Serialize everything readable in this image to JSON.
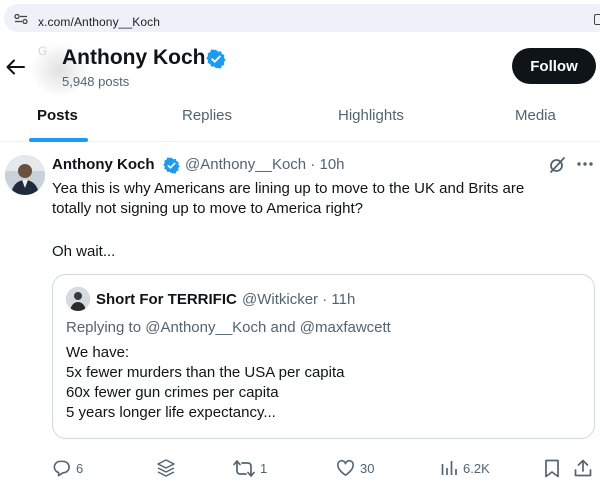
{
  "browser": {
    "url": "x.com/Anthony__Koch"
  },
  "header": {
    "name": "Anthony Koch",
    "posts_count": "5,948 posts",
    "follow_label": "Follow",
    "ghost_text": "G"
  },
  "tabs": [
    {
      "label": "Posts",
      "active": true
    },
    {
      "label": "Replies",
      "active": false
    },
    {
      "label": "Highlights",
      "active": false
    },
    {
      "label": "Media",
      "active": false
    }
  ],
  "tweet": {
    "author_name": "Anthony Koch",
    "handle_time": "@Anthony__Koch · 10h",
    "text_line1": "Yea this is why Americans are lining up to move to the UK and Brits are",
    "text_line2": "totally not signing up to move to America right?",
    "text_line3": "Oh wait...",
    "quote": {
      "author_name": "Short For TERRIFIC",
      "handle_time": "@Witkicker · 11h",
      "replying_prefix": "Replying to ",
      "reply_to_1": "@Anthony__Koch",
      "reply_and": " and ",
      "reply_to_2": "@maxfawcett",
      "lines": [
        "We have:",
        "5x fewer murders than the USA per capita",
        "60x fewer gun crimes per capita",
        "5 years longer life expectancy..."
      ]
    },
    "actions": {
      "replies": "6",
      "reposts": "1",
      "likes": "30",
      "views": "6.2K"
    }
  },
  "colors": {
    "accent": "#1d9bf0",
    "text": "#0f1419",
    "muted": "#536471",
    "follow_bg": "#0f1419"
  }
}
